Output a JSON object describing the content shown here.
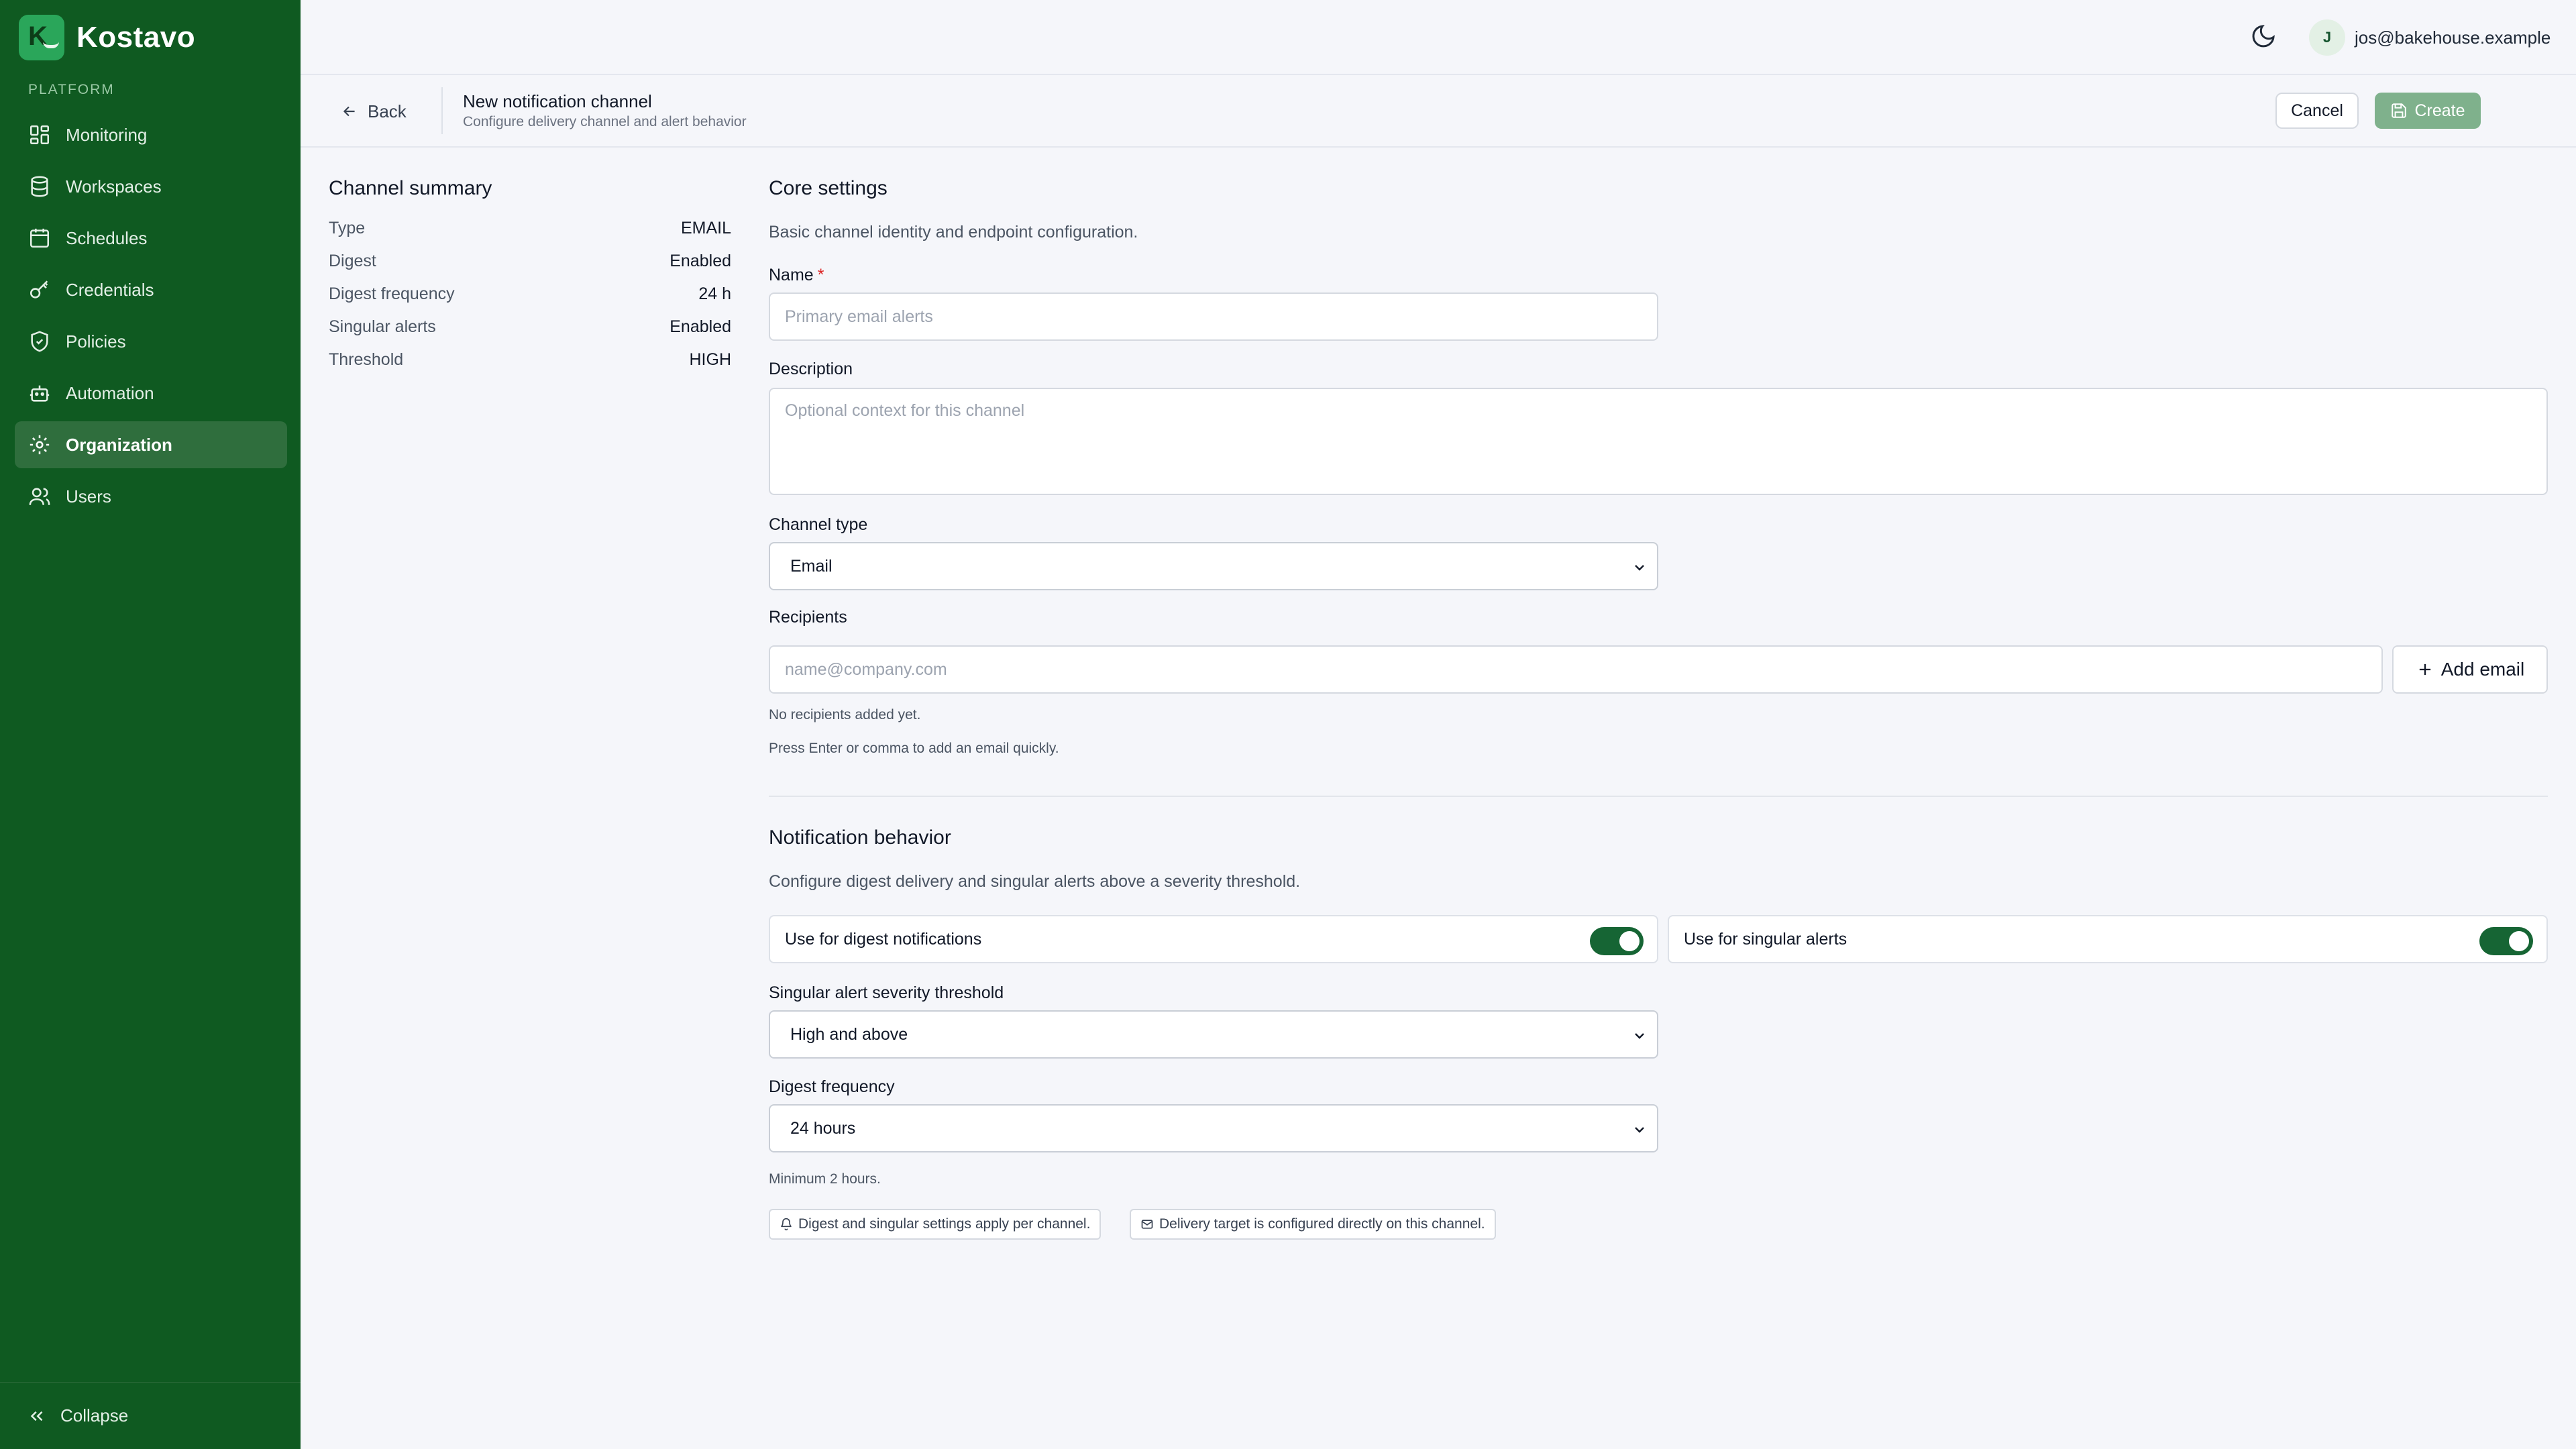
{
  "brand": {
    "name": "Kostavo",
    "logo_letter": "K"
  },
  "sidebar": {
    "section_label": "PLATFORM",
    "items": [
      {
        "label": "Monitoring",
        "icon": "dashboard-icon"
      },
      {
        "label": "Workspaces",
        "icon": "database-icon"
      },
      {
        "label": "Schedules",
        "icon": "calendar-icon"
      },
      {
        "label": "Credentials",
        "icon": "key-icon"
      },
      {
        "label": "Policies",
        "icon": "shield-icon"
      },
      {
        "label": "Automation",
        "icon": "bot-icon"
      },
      {
        "label": "Organization",
        "icon": "gear-icon",
        "active": true
      },
      {
        "label": "Users",
        "icon": "users-icon"
      }
    ],
    "collapse_label": "Collapse"
  },
  "topbar": {
    "user_initial": "J",
    "user_email": "jos@bakehouse.example"
  },
  "header": {
    "back_label": "Back",
    "title": "New notification channel",
    "subtitle": "Configure delivery channel and alert behavior",
    "cancel_label": "Cancel",
    "create_label": "Create"
  },
  "summary": {
    "title": "Channel summary",
    "rows": [
      {
        "key": "Type",
        "value": "EMAIL"
      },
      {
        "key": "Digest",
        "value": "Enabled"
      },
      {
        "key": "Digest frequency",
        "value": "24 h"
      },
      {
        "key": "Singular alerts",
        "value": "Enabled"
      },
      {
        "key": "Threshold",
        "value": "HIGH"
      }
    ]
  },
  "core": {
    "title": "Core settings",
    "description": "Basic channel identity and endpoint configuration.",
    "name_label": "Name",
    "name_required": "*",
    "name_placeholder": "Primary email alerts",
    "desc_label": "Description",
    "desc_placeholder": "Optional context for this channel",
    "type_label": "Channel type",
    "type_value": "Email",
    "recipients_label": "Recipients",
    "recipients_placeholder": "name@company.com",
    "add_email_label": "Add email",
    "no_recipients": "No recipients added yet.",
    "recipients_hint": "Press Enter or comma to add an email quickly."
  },
  "behavior": {
    "title": "Notification behavior",
    "description": "Configure digest delivery and singular alerts above a severity threshold.",
    "digest_toggle_label": "Use for digest notifications",
    "digest_toggle_on": true,
    "singular_toggle_label": "Use for singular alerts",
    "singular_toggle_on": true,
    "threshold_label": "Singular alert severity threshold",
    "threshold_value": "High and above",
    "frequency_label": "Digest frequency",
    "frequency_value": "24 hours",
    "frequency_hint": "Minimum 2 hours.",
    "chip_1": "Digest and singular settings apply per channel.",
    "chip_2": "Delivery target is configured directly on this channel."
  },
  "colors": {
    "sidebar_bg": "#0f5a21",
    "accent": "#166534",
    "create_button": "#7fb18c"
  }
}
